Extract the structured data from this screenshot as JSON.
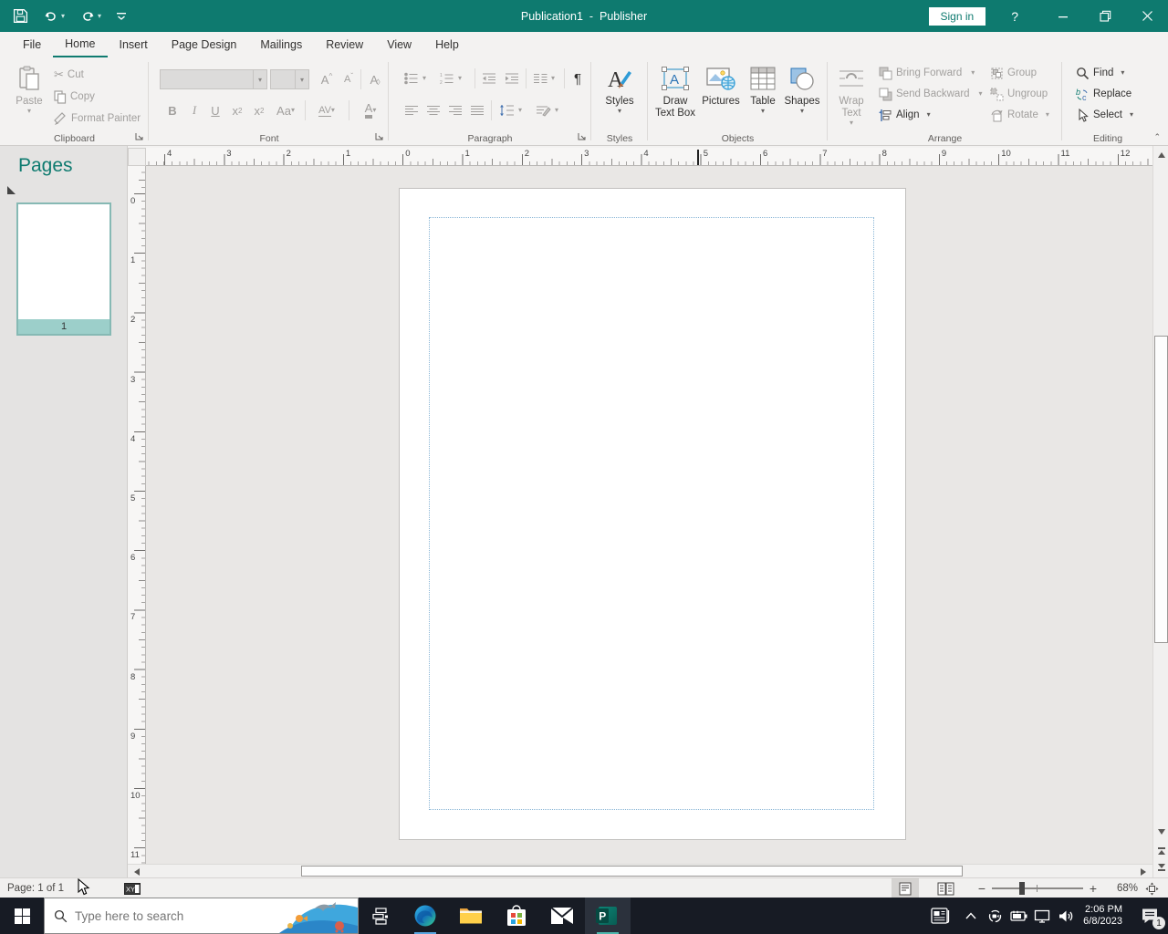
{
  "titlebar": {
    "title": "Publication1  -  Publisher",
    "sign_in": "Sign in",
    "help": "?"
  },
  "menubar": {
    "tabs": [
      "File",
      "Home",
      "Insert",
      "Page Design",
      "Mailings",
      "Review",
      "View",
      "Help"
    ],
    "active_tab": "Home"
  },
  "ribbon": {
    "clipboard": {
      "label": "Clipboard",
      "paste": "Paste",
      "cut": "Cut",
      "copy": "Copy",
      "format_painter": "Format Painter"
    },
    "font": {
      "label": "Font",
      "bold": "B",
      "italic": "I",
      "underline": "U",
      "subscript_x": "x",
      "subscript_n": "2",
      "superscript_x": "x",
      "superscript_n": "2",
      "change_case": "Aa",
      "char_spacing": "AV",
      "font_color": "A",
      "grow_font": "A",
      "shrink_font": "A",
      "clear_formatting": "A"
    },
    "paragraph": {
      "label": "Paragraph",
      "pilcrow": "¶"
    },
    "styles": {
      "label": "Styles",
      "button": "Styles"
    },
    "objects": {
      "label": "Objects",
      "draw_text_box": "Draw Text Box",
      "pictures": "Pictures",
      "table": "Table",
      "shapes": "Shapes"
    },
    "arrange": {
      "label": "Arrange",
      "wrap_text": "Wrap Text",
      "bring_forward": "Bring Forward",
      "send_backward": "Send Backward",
      "align": "Align",
      "group": "Group",
      "ungroup": "Ungroup",
      "rotate": "Rotate"
    },
    "editing": {
      "label": "Editing",
      "find": "Find",
      "replace": "Replace",
      "select": "Select"
    }
  },
  "pages_panel": {
    "title": "Pages",
    "page_number": "1"
  },
  "rulers": {
    "horizontal_numbers": [
      "4",
      "3",
      "2",
      "1",
      "0",
      "1",
      "2",
      "3",
      "4",
      "5",
      "6",
      "7",
      "8",
      "9",
      "10",
      "11",
      "12"
    ],
    "vertical_numbers": [
      "0",
      "1",
      "2",
      "3",
      "4",
      "5",
      "6",
      "7",
      "8",
      "9",
      "10",
      "11"
    ]
  },
  "statusbar": {
    "page_indicator": "Page: 1 of 1",
    "object_position": "XY",
    "zoom_percent": "68%"
  },
  "taskbar": {
    "search_placeholder": "Type here to search",
    "time": "2:06 PM",
    "date": "6/8/2023",
    "notification_count": "1"
  },
  "icons": {
    "save": "floppy-disk",
    "undo": "arrow-curved-left",
    "redo": "arrow-curved-right",
    "customize_qat": "bar-chevron",
    "minimize": "dash",
    "restore": "overlapping-squares",
    "close": "x",
    "paste": "clipboard",
    "cut": "scissors",
    "copy": "two-pages",
    "format_painter": "brush",
    "find": "magnifier",
    "select": "arrow-pointer",
    "start": "windows-logo",
    "search": "magnifier"
  },
  "colors": {
    "titlebar_teal": "#0e7a6f",
    "accent_teal": "#0f7b70",
    "ribbon_bg": "#f3f2f1",
    "disabled_gray": "#a19f9d",
    "taskbar_bg": "#171b24",
    "margin_guide_blue": "#8ab6d6",
    "edge_underline": "#58a6e0",
    "thumb_strip": "#9ccfca"
  }
}
